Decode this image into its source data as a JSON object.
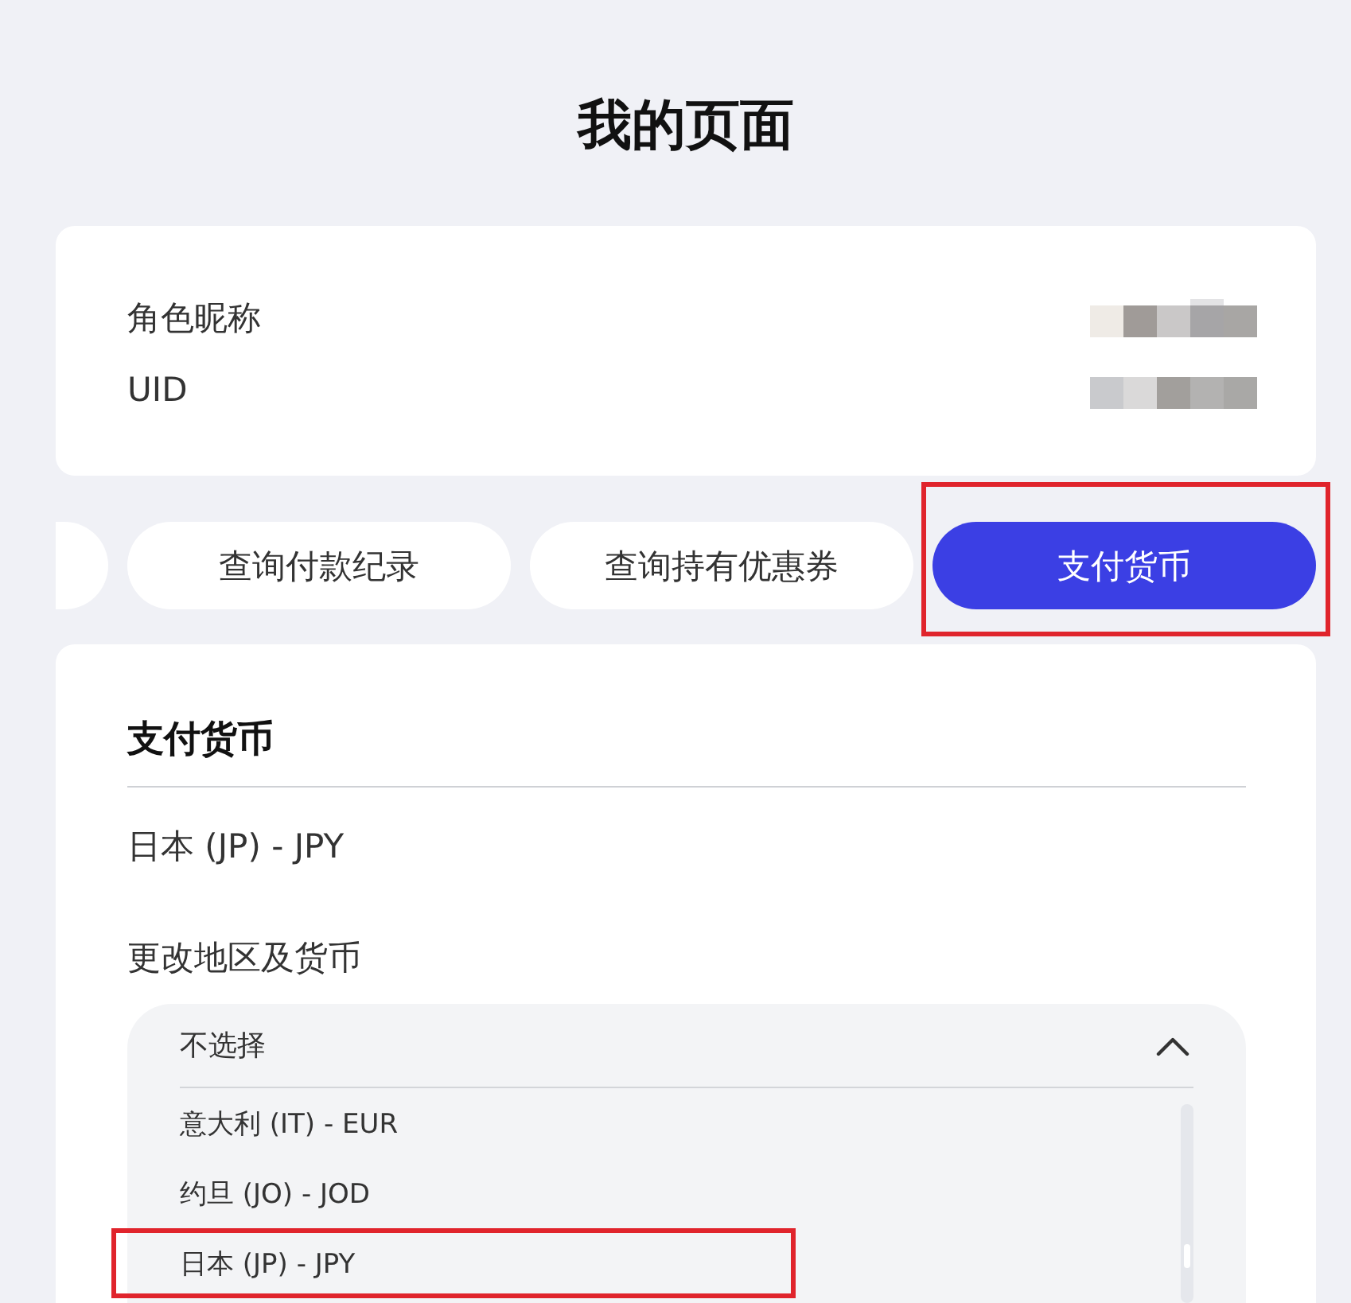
{
  "page": {
    "title": "我的页面"
  },
  "profile": {
    "fields": [
      {
        "label": "角色昵称"
      },
      {
        "label": "UID"
      }
    ]
  },
  "tabs": [
    {
      "kind": "cut",
      "selected": false,
      "highlighted": false
    },
    {
      "kind": "tab",
      "label": "查询付款纪录",
      "selected": false,
      "highlighted": false
    },
    {
      "kind": "tab",
      "label": "查询持有优惠券",
      "selected": false,
      "highlighted": false
    },
    {
      "kind": "tab",
      "label": "支付货币",
      "selected": true,
      "highlighted": true
    }
  ],
  "currency": {
    "heading": "支付货币",
    "current": "日本 (JP) - JPY",
    "change_label": "更改地区及货币",
    "dropdown": {
      "value": "不选择",
      "expanded": true,
      "options": [
        {
          "label": "意大利 (IT) - EUR",
          "highlighted": false
        },
        {
          "label": "约旦 (JO) - JOD",
          "highlighted": false
        },
        {
          "label": "日本 (JP) - JPY",
          "highlighted": true
        }
      ]
    }
  }
}
